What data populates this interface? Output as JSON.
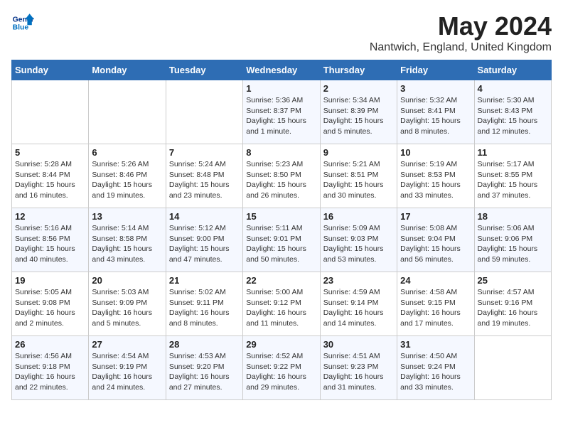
{
  "logo": {
    "line1": "General",
    "line2": "Blue"
  },
  "title": "May 2024",
  "location": "Nantwich, England, United Kingdom",
  "days_of_week": [
    "Sunday",
    "Monday",
    "Tuesday",
    "Wednesday",
    "Thursday",
    "Friday",
    "Saturday"
  ],
  "weeks": [
    [
      {
        "num": "",
        "info": ""
      },
      {
        "num": "",
        "info": ""
      },
      {
        "num": "",
        "info": ""
      },
      {
        "num": "1",
        "info": "Sunrise: 5:36 AM\nSunset: 8:37 PM\nDaylight: 15 hours\nand 1 minute."
      },
      {
        "num": "2",
        "info": "Sunrise: 5:34 AM\nSunset: 8:39 PM\nDaylight: 15 hours\nand 5 minutes."
      },
      {
        "num": "3",
        "info": "Sunrise: 5:32 AM\nSunset: 8:41 PM\nDaylight: 15 hours\nand 8 minutes."
      },
      {
        "num": "4",
        "info": "Sunrise: 5:30 AM\nSunset: 8:43 PM\nDaylight: 15 hours\nand 12 minutes."
      }
    ],
    [
      {
        "num": "5",
        "info": "Sunrise: 5:28 AM\nSunset: 8:44 PM\nDaylight: 15 hours\nand 16 minutes."
      },
      {
        "num": "6",
        "info": "Sunrise: 5:26 AM\nSunset: 8:46 PM\nDaylight: 15 hours\nand 19 minutes."
      },
      {
        "num": "7",
        "info": "Sunrise: 5:24 AM\nSunset: 8:48 PM\nDaylight: 15 hours\nand 23 minutes."
      },
      {
        "num": "8",
        "info": "Sunrise: 5:23 AM\nSunset: 8:50 PM\nDaylight: 15 hours\nand 26 minutes."
      },
      {
        "num": "9",
        "info": "Sunrise: 5:21 AM\nSunset: 8:51 PM\nDaylight: 15 hours\nand 30 minutes."
      },
      {
        "num": "10",
        "info": "Sunrise: 5:19 AM\nSunset: 8:53 PM\nDaylight: 15 hours\nand 33 minutes."
      },
      {
        "num": "11",
        "info": "Sunrise: 5:17 AM\nSunset: 8:55 PM\nDaylight: 15 hours\nand 37 minutes."
      }
    ],
    [
      {
        "num": "12",
        "info": "Sunrise: 5:16 AM\nSunset: 8:56 PM\nDaylight: 15 hours\nand 40 minutes."
      },
      {
        "num": "13",
        "info": "Sunrise: 5:14 AM\nSunset: 8:58 PM\nDaylight: 15 hours\nand 43 minutes."
      },
      {
        "num": "14",
        "info": "Sunrise: 5:12 AM\nSunset: 9:00 PM\nDaylight: 15 hours\nand 47 minutes."
      },
      {
        "num": "15",
        "info": "Sunrise: 5:11 AM\nSunset: 9:01 PM\nDaylight: 15 hours\nand 50 minutes."
      },
      {
        "num": "16",
        "info": "Sunrise: 5:09 AM\nSunset: 9:03 PM\nDaylight: 15 hours\nand 53 minutes."
      },
      {
        "num": "17",
        "info": "Sunrise: 5:08 AM\nSunset: 9:04 PM\nDaylight: 15 hours\nand 56 minutes."
      },
      {
        "num": "18",
        "info": "Sunrise: 5:06 AM\nSunset: 9:06 PM\nDaylight: 15 hours\nand 59 minutes."
      }
    ],
    [
      {
        "num": "19",
        "info": "Sunrise: 5:05 AM\nSunset: 9:08 PM\nDaylight: 16 hours\nand 2 minutes."
      },
      {
        "num": "20",
        "info": "Sunrise: 5:03 AM\nSunset: 9:09 PM\nDaylight: 16 hours\nand 5 minutes."
      },
      {
        "num": "21",
        "info": "Sunrise: 5:02 AM\nSunset: 9:11 PM\nDaylight: 16 hours\nand 8 minutes."
      },
      {
        "num": "22",
        "info": "Sunrise: 5:00 AM\nSunset: 9:12 PM\nDaylight: 16 hours\nand 11 minutes."
      },
      {
        "num": "23",
        "info": "Sunrise: 4:59 AM\nSunset: 9:14 PM\nDaylight: 16 hours\nand 14 minutes."
      },
      {
        "num": "24",
        "info": "Sunrise: 4:58 AM\nSunset: 9:15 PM\nDaylight: 16 hours\nand 17 minutes."
      },
      {
        "num": "25",
        "info": "Sunrise: 4:57 AM\nSunset: 9:16 PM\nDaylight: 16 hours\nand 19 minutes."
      }
    ],
    [
      {
        "num": "26",
        "info": "Sunrise: 4:56 AM\nSunset: 9:18 PM\nDaylight: 16 hours\nand 22 minutes."
      },
      {
        "num": "27",
        "info": "Sunrise: 4:54 AM\nSunset: 9:19 PM\nDaylight: 16 hours\nand 24 minutes."
      },
      {
        "num": "28",
        "info": "Sunrise: 4:53 AM\nSunset: 9:20 PM\nDaylight: 16 hours\nand 27 minutes."
      },
      {
        "num": "29",
        "info": "Sunrise: 4:52 AM\nSunset: 9:22 PM\nDaylight: 16 hours\nand 29 minutes."
      },
      {
        "num": "30",
        "info": "Sunrise: 4:51 AM\nSunset: 9:23 PM\nDaylight: 16 hours\nand 31 minutes."
      },
      {
        "num": "31",
        "info": "Sunrise: 4:50 AM\nSunset: 9:24 PM\nDaylight: 16 hours\nand 33 minutes."
      },
      {
        "num": "",
        "info": ""
      }
    ]
  ]
}
